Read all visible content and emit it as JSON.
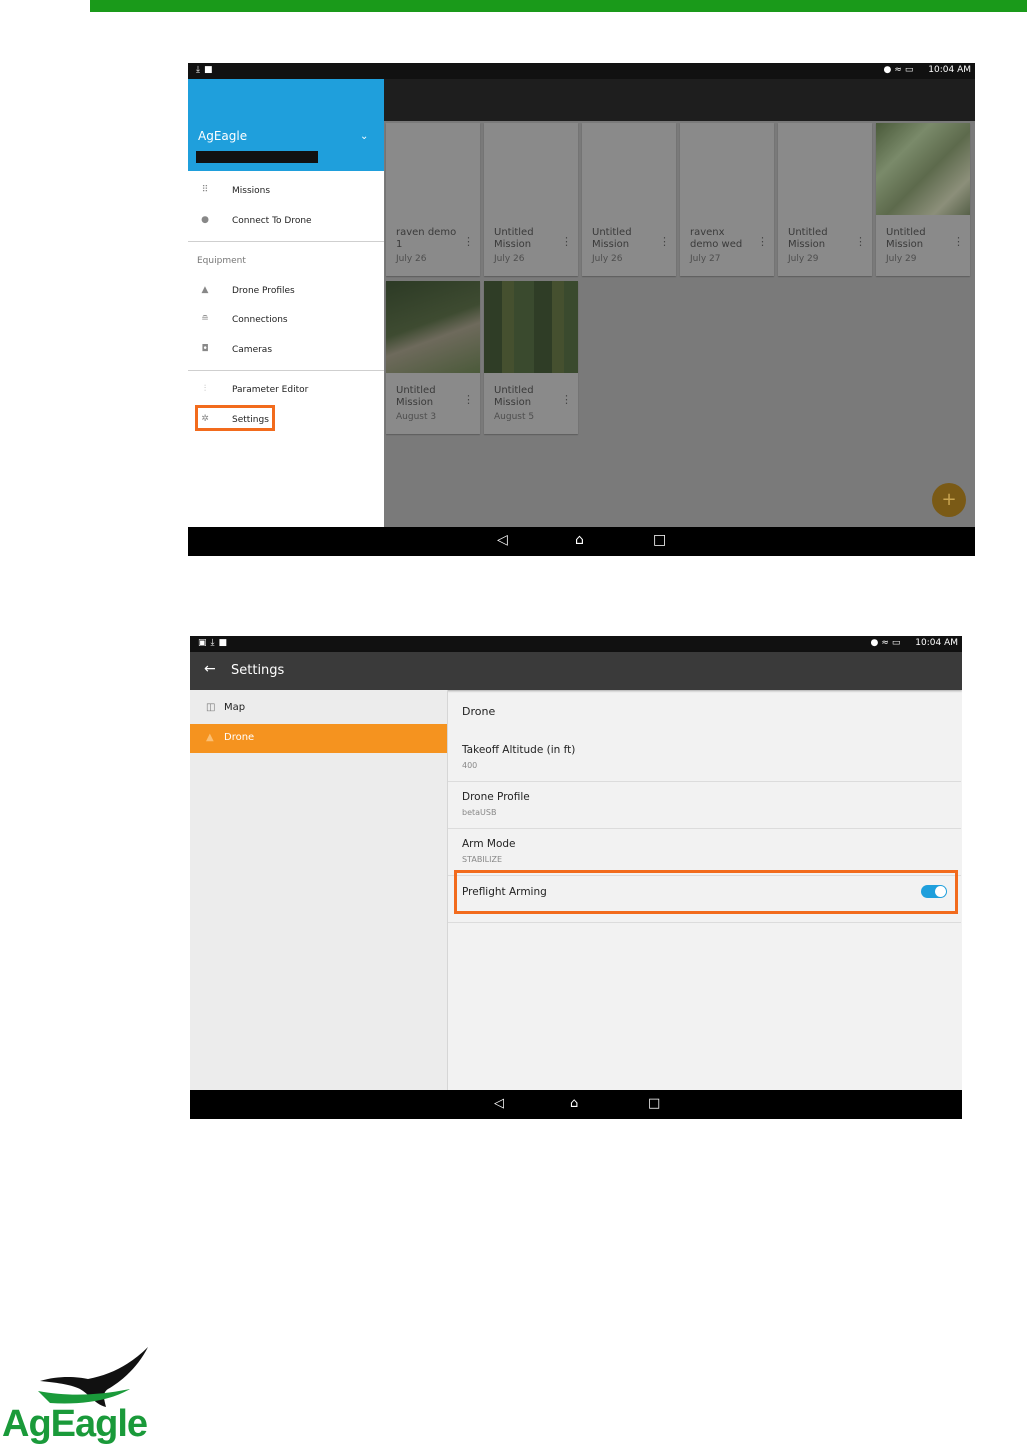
{
  "shot1": {
    "status": {
      "left_icons": [
        "download-icon",
        "bag-icon"
      ],
      "right_icons": [
        "location-icon",
        "wifi-icon",
        "battery-icon"
      ],
      "time": "10:04 AM"
    },
    "drawer": {
      "brand": "AgEagle",
      "items_main": [
        {
          "label": "Missions",
          "icon": "grid-icon"
        },
        {
          "label": "Connect To Drone",
          "icon": "dot-icon"
        }
      ],
      "section_equipment": "Equipment",
      "items_equipment": [
        {
          "label": "Drone Profiles",
          "icon": "drone-icon"
        },
        {
          "label": "Connections",
          "icon": "router-icon"
        },
        {
          "label": "Cameras",
          "icon": "camera-icon"
        }
      ],
      "items_tools": [
        {
          "label": "Parameter Editor",
          "icon": "sliders-icon"
        },
        {
          "label": "Settings",
          "icon": "gear-icon"
        }
      ]
    },
    "missions": [
      {
        "title": "raven demo\n1",
        "date": "July 26"
      },
      {
        "title": "Untitled\nMission",
        "date": "July 26"
      },
      {
        "title": "Untitled\nMission",
        "date": "July 26"
      },
      {
        "title": "ravenx\ndemo wed",
        "date": "July 27"
      },
      {
        "title": "Untitled\nMission",
        "date": "July 29"
      },
      {
        "title": "Untitled\nMission",
        "date": "July 29"
      },
      {
        "title": "Untitled\nMission",
        "date": "August 3"
      },
      {
        "title": "Untitled\nMission",
        "date": "August 5"
      }
    ],
    "fab_label": "+",
    "nav": {
      "back": "◁",
      "home": "⌂",
      "recents": "□"
    }
  },
  "shot2": {
    "status": {
      "left_icons": [
        "image-icon",
        "download-icon",
        "bag-icon"
      ],
      "right_icons": [
        "location-icon",
        "wifi-icon",
        "battery-icon"
      ],
      "time": "10:04 AM"
    },
    "title": "Settings",
    "left_items": [
      {
        "label": "Map",
        "icon": "map-icon",
        "selected": false
      },
      {
        "label": "Drone",
        "icon": "drone-icon",
        "selected": true
      }
    ],
    "section": "Drone",
    "prefs": [
      {
        "title": "Takeoff Altitude (in ft)",
        "value": "400"
      },
      {
        "title": "Drone Profile",
        "value": "betaUSB"
      },
      {
        "title": "Arm Mode",
        "value": "STABILIZE"
      }
    ],
    "preflight": {
      "title": "Preflight Arming",
      "enabled": true
    },
    "nav": {
      "back": "◁",
      "home": "⌂",
      "recents": "□"
    }
  },
  "logo": {
    "text": "AgEagle"
  },
  "colors": {
    "accent_green": "#1a9a1a",
    "drawer_blue": "#1f9fdc",
    "selected_orange": "#f5931f",
    "highlight_orange": "#f26b1d"
  }
}
